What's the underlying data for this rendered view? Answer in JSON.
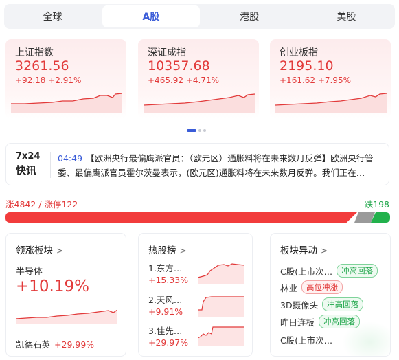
{
  "tabs": [
    "全球",
    "A股",
    "港股",
    "美股"
  ],
  "active_tab": "A股",
  "indices": [
    {
      "name": "上证指数",
      "value": "3261.56",
      "change": "+92.18  +2.91%"
    },
    {
      "name": "深证成指",
      "value": "10357.68",
      "change": "+465.92  +4.71%"
    },
    {
      "name": "创业板指",
      "value": "2195.10",
      "change": "+161.62  +7.95%"
    }
  ],
  "news": {
    "logo_line1": "7x24",
    "logo_line2": "快讯",
    "time": "04:49",
    "text": "【欧洲央行最偏鹰派官员：（欧元区）通胀料将在未来数月反弹】欧洲央行管委、最偏鹰派官员霍尔茨曼表示，(欧元区)通胀料将在未来数月反弹。我们正在…"
  },
  "breadth": {
    "up_text": "涨4842 / 涨停122",
    "down_text": "跌198"
  },
  "leading_sector": {
    "title": "领涨板块",
    "sector": "半导体",
    "pct": "+10.19%",
    "top_stock": "凯德石英",
    "top_stock_pct": "+29.99%"
  },
  "hot_stocks": {
    "title": "热股榜",
    "items": [
      {
        "name": "1.东方…",
        "pct": "+15.33%"
      },
      {
        "name": "2.天风…",
        "pct": "+9.91%"
      },
      {
        "name": "3.佳先…",
        "pct": "+29.97%"
      }
    ]
  },
  "sector_moves": {
    "title": "板块异动",
    "items": [
      {
        "name": "C股(上市次…",
        "tag": "冲高回落",
        "tag_color": "green"
      },
      {
        "name": "林业",
        "tag": "高位冲涨",
        "tag_color": "red"
      },
      {
        "name": "3D摄像头",
        "tag": "冲高回落",
        "tag_color": "green"
      },
      {
        "name": "昨日连板",
        "tag": "冲高回落",
        "tag_color": "green"
      },
      {
        "name": "C股(上市次…",
        "tag": "",
        "tag_color": ""
      }
    ]
  },
  "colors": {
    "up": "#e23a3a",
    "down": "#1fa64a",
    "accent": "#3a5cd8"
  }
}
